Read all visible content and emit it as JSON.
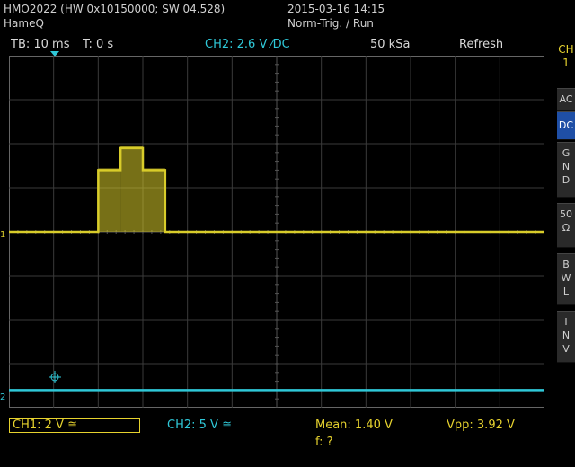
{
  "header": {
    "device": "HMO2022 (HW 0x10150000; SW 04.528)",
    "vendor": "HameQ",
    "datetime": "2015-03-16 14:15",
    "trigger_mode": "Norm-Trig. / Run"
  },
  "status_bar": {
    "timebase": "TB: 10 ms",
    "time_offset": "T: 0 s",
    "trigger_level": "CH2: 2.6 V ⁄DC",
    "sample_rate": "50 kSa",
    "mode": "Refresh"
  },
  "side_menu": {
    "channel_label": "CH 1",
    "buttons": [
      {
        "label": "AC",
        "active": false
      },
      {
        "label": "DC",
        "active": true
      },
      {
        "label": "G N D",
        "active": false
      },
      {
        "label": "50 Ω",
        "active": false
      },
      {
        "label": "B W L",
        "active": false
      },
      {
        "label": "I N V",
        "active": false
      }
    ]
  },
  "bottom": {
    "ch1": "CH1: 2 V ≅",
    "ch2": "CH2: 5 V ≅",
    "mean": "Mean: 1.40 V",
    "vpp": "Vpp: 3.92 V",
    "freq": "f: ?"
  },
  "markers": {
    "ch1": "1",
    "ch2": "2"
  },
  "colors": {
    "ch1": "#d8cc2a",
    "ch2": "#2fc8d8",
    "active": "#1f4fa6",
    "grid": "#3a3a3a"
  },
  "chart_data": {
    "type": "line",
    "x_unit": "ms",
    "y_unit": "div",
    "xlim": [
      -60,
      60
    ],
    "ylim": [
      -4,
      4
    ],
    "series": [
      {
        "points": [
          [
            -60,
            0
          ],
          [
            -40,
            0
          ],
          [
            -40,
            1.4
          ],
          [
            -35,
            1.4
          ],
          [
            -35,
            1.9
          ],
          [
            -30,
            1.9
          ],
          [
            -30,
            1.4
          ],
          [
            -25,
            1.4
          ],
          [
            -25,
            0
          ],
          [
            60,
            0
          ]
        ]
      },
      {
        "points": [
          [
            -60,
            -3.6
          ],
          [
            60,
            -3.6
          ]
        ]
      }
    ]
  }
}
